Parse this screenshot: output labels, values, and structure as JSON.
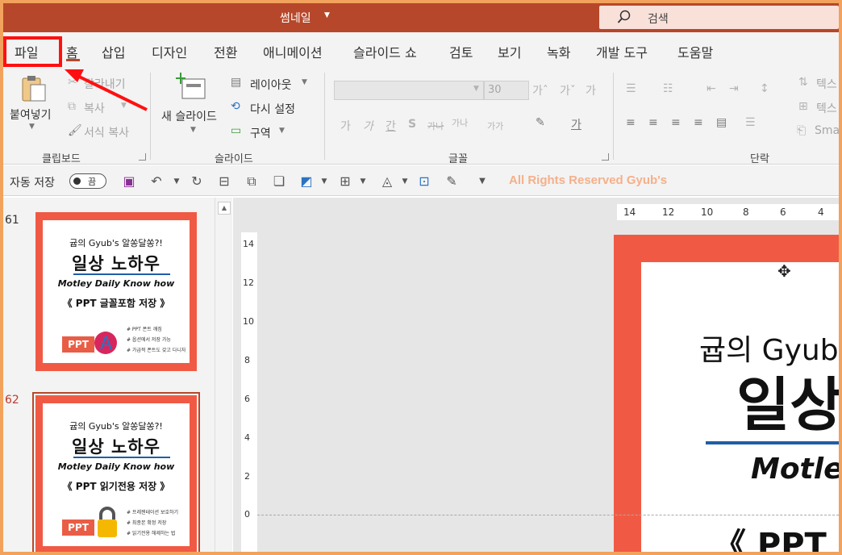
{
  "app": {
    "doc_title": "썸네일"
  },
  "search": {
    "placeholder": "검색"
  },
  "tabs": [
    {
      "label": "파일"
    },
    {
      "label": "홈"
    },
    {
      "label": "삽입"
    },
    {
      "label": "디자인"
    },
    {
      "label": "전환"
    },
    {
      "label": "애니메이션"
    },
    {
      "label": "슬라이드 쇼"
    },
    {
      "label": "검토"
    },
    {
      "label": "보기"
    },
    {
      "label": "녹화"
    },
    {
      "label": "개발 도구"
    },
    {
      "label": "도움말"
    }
  ],
  "ribbon": {
    "clipboard": {
      "paste": "붙여넣기",
      "cut": "잘라내기",
      "copy": "복사",
      "format_painter": "서식 복사",
      "group": "클립보드"
    },
    "slides": {
      "new_slide": "새 슬라이드",
      "layout": "레이아웃",
      "reset": "다시 설정",
      "section": "구역",
      "group": "슬라이드"
    },
    "font": {
      "size": "30",
      "group": "글꼴",
      "bold": "가",
      "italic": "가",
      "underline": "간",
      "shadow": "S",
      "strike": "가나",
      "spacing": "가나",
      "case": "가가"
    },
    "paragraph": {
      "group": "단락",
      "text_direction": "텍스",
      "align_text": "텍스",
      "smartart": "Sma"
    }
  },
  "qat": {
    "autosave_label": "자동 저장",
    "autosave_state": "끔",
    "watermark": "All Rights Reserved Gyub's"
  },
  "thumbnails": [
    {
      "number": "61",
      "top": "귭의 Gyub's 알쏭달쏭?!",
      "main": "일상 노하우",
      "sub": "Motley Daily Know how",
      "title": "《 PPT 글꼴포함 저장 》",
      "badge": "PPT",
      "bullets": [
        "# PPT 폰트 깨짐",
        "# 옵션에서 저장 가능",
        "# 가급적 폰트도 갖고 다니자"
      ],
      "selected": false
    },
    {
      "number": "62",
      "top": "귭의 Gyub's 알쏭달쏭?!",
      "main": "일상 노하우",
      "sub": "Motley Daily Know how",
      "title": "《 PPT 읽기전용 저장 》",
      "badge": "PPT",
      "bullets": [
        "# 프레젠테이션 보호하기",
        "# 최종본 확정 저장",
        "# 읽기전용 해제하는 법"
      ],
      "selected": true
    }
  ],
  "hruler": [
    "14",
    "12",
    "10",
    "8",
    "6",
    "4"
  ],
  "vruler": [
    "14",
    "12",
    "10",
    "8",
    "6",
    "4",
    "2",
    "0"
  ],
  "slide": {
    "top": "귭의 Gyub",
    "main": "일상",
    "sub": "Motley",
    "title": "《 PPT 읽"
  },
  "colors": {
    "title_bar": "#b7472a",
    "slide_border": "#f05a44",
    "highlight": "#ff1010",
    "watermark": "#f5b08a"
  }
}
